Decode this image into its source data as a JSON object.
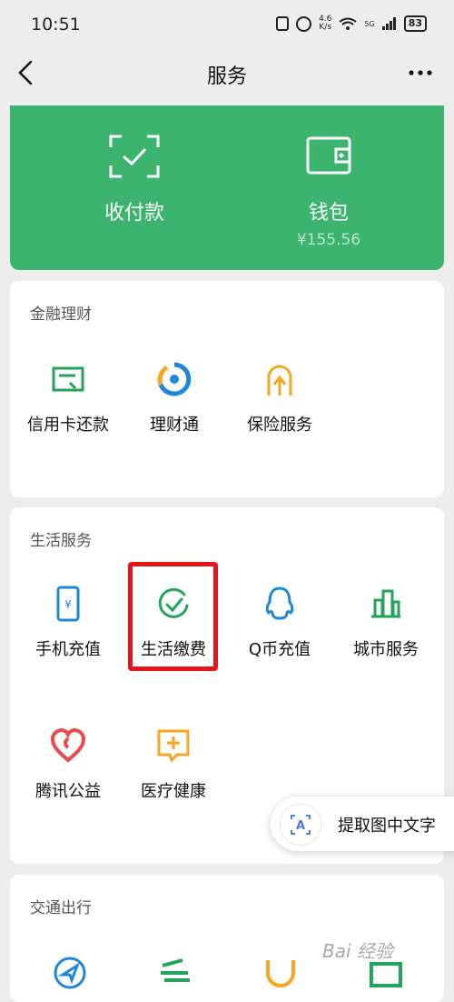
{
  "status_bar": {
    "time": "10:51",
    "net_speed_value": "4.6",
    "net_speed_unit": "K/s",
    "signal_label": "5G",
    "battery": "83"
  },
  "nav": {
    "title": "服务"
  },
  "wallet_card": {
    "pay_label": "收付款",
    "wallet_label": "钱包",
    "wallet_balance": "¥155.56",
    "color": "#3cb46e"
  },
  "finance": {
    "title": "金融理财",
    "items": [
      {
        "label": "信用卡还款",
        "icon": "credit-card-icon"
      },
      {
        "label": "理财通",
        "icon": "wealth-icon"
      },
      {
        "label": "保险服务",
        "icon": "insurance-icon"
      }
    ]
  },
  "life": {
    "title": "生活服务",
    "items": [
      {
        "label": "手机充值",
        "icon": "phone-icon"
      },
      {
        "label": "生活缴费",
        "icon": "check-circle-icon"
      },
      {
        "label": "Q币充值",
        "icon": "qq-icon"
      },
      {
        "label": "城市服务",
        "icon": "city-icon"
      },
      {
        "label": "腾讯公益",
        "icon": "heart-icon"
      },
      {
        "label": "医疗健康",
        "icon": "medical-icon"
      }
    ]
  },
  "transport": {
    "title": "交通出行"
  },
  "ocr": {
    "label": "提取图中文字"
  },
  "watermark": "Bai 经验"
}
